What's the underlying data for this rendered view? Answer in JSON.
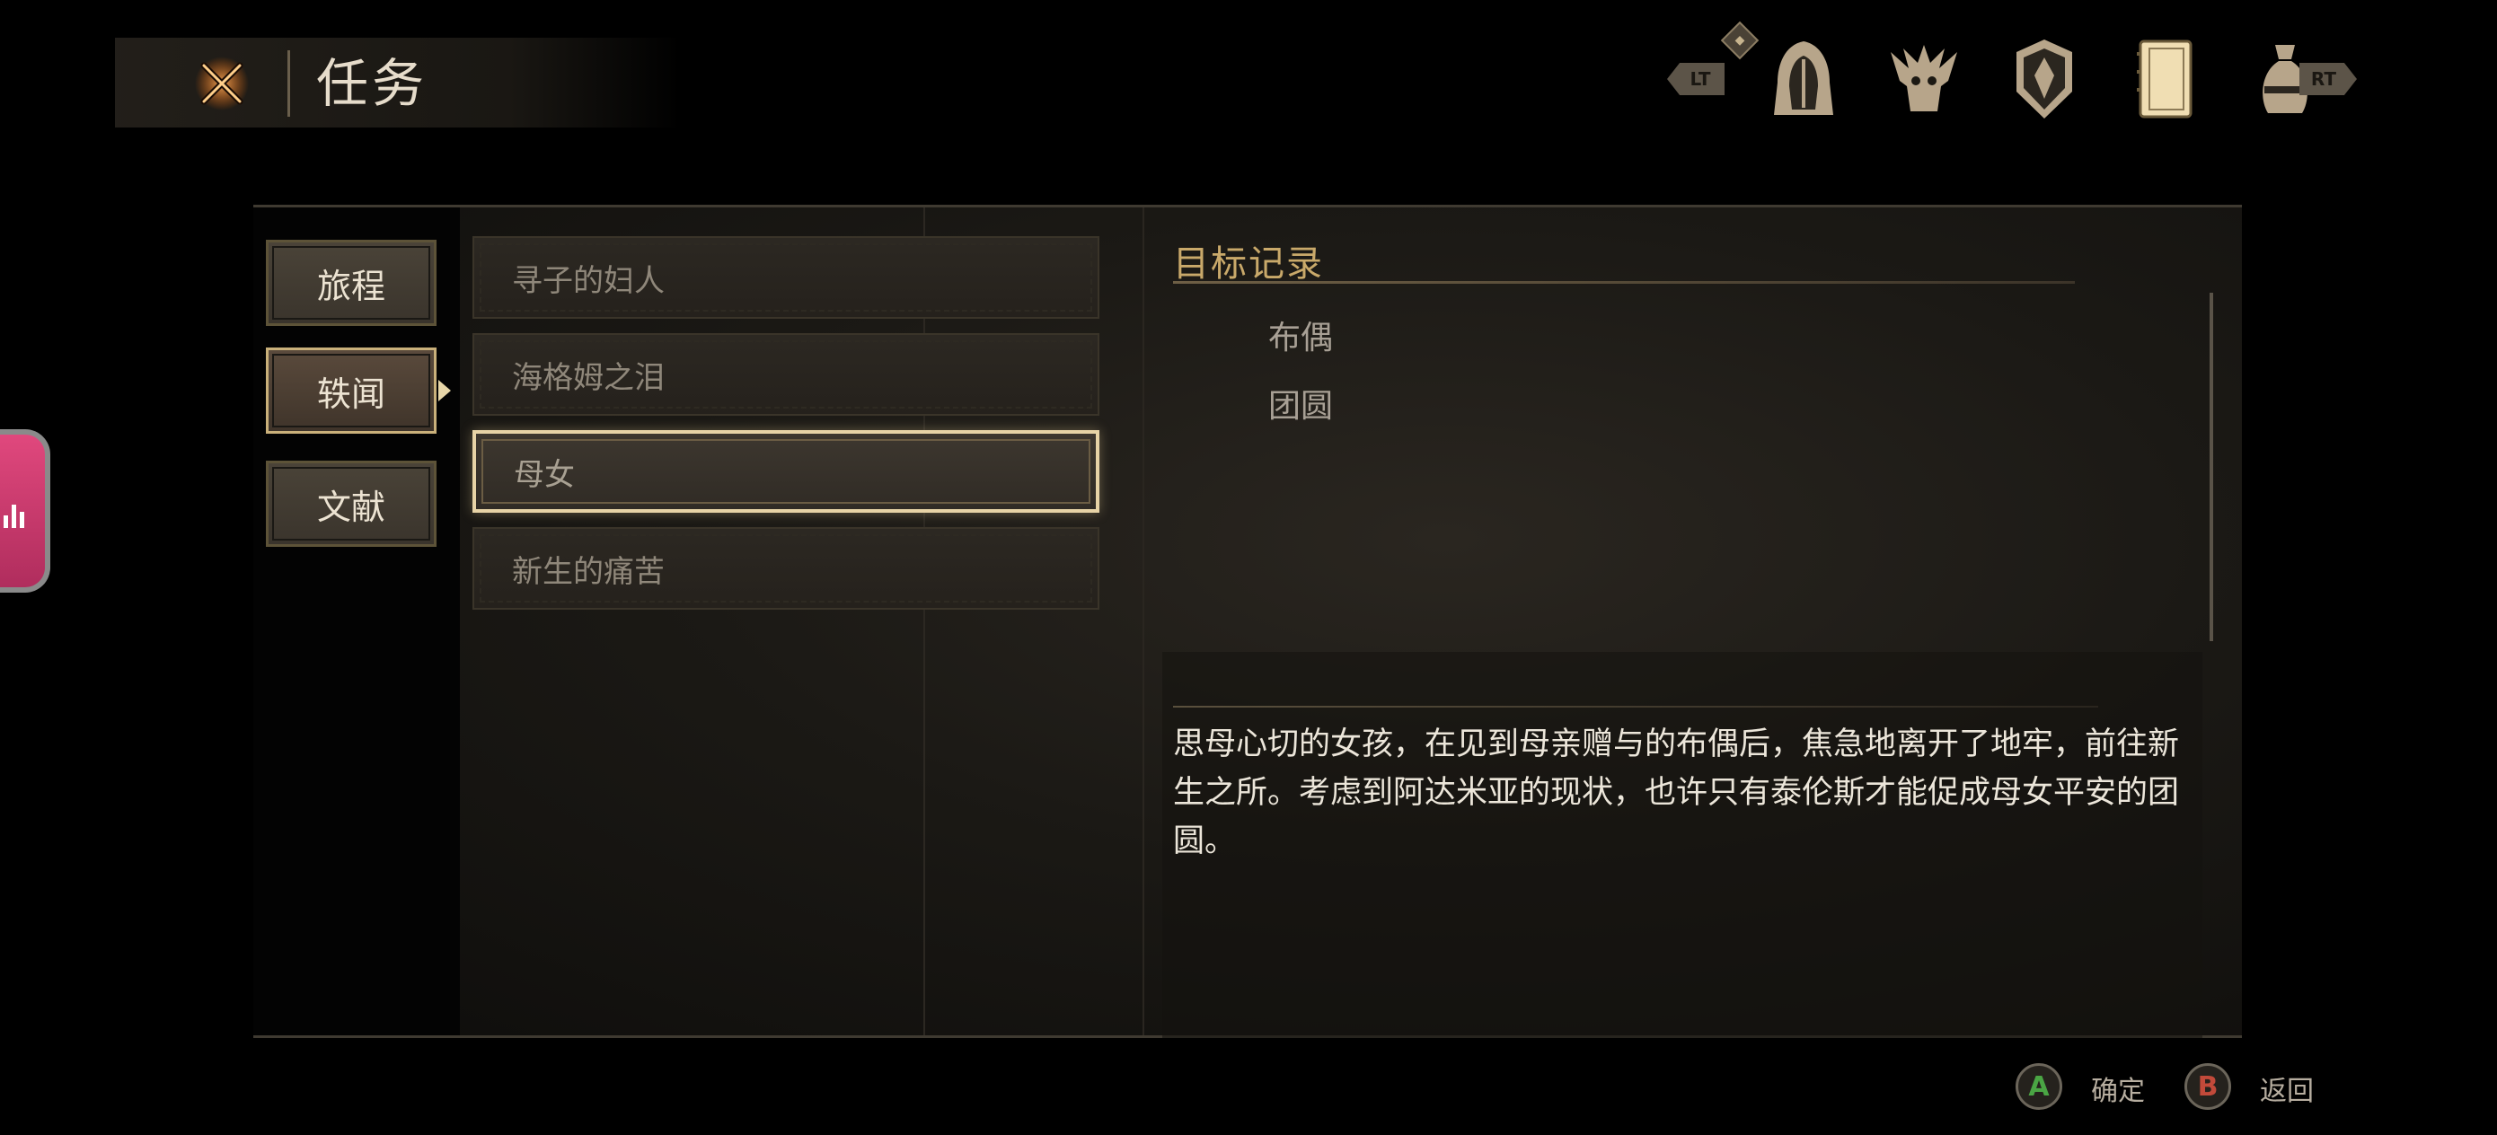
{
  "header": {
    "title": "任务",
    "close_icon": "crossed-swords-icon"
  },
  "topbar": {
    "left_bumper": "LT",
    "right_bumper": "RT",
    "tabs": [
      {
        "name": "hooded-knight-icon"
      },
      {
        "name": "demon-skull-icon"
      },
      {
        "name": "emblem-shield-icon"
      },
      {
        "name": "journal-book-icon"
      },
      {
        "name": "money-bag-icon"
      }
    ],
    "accent": "#c7b48e"
  },
  "categories": [
    {
      "label": "旅程",
      "active": false
    },
    {
      "label": "轶闻",
      "active": true
    },
    {
      "label": "文献",
      "active": false
    }
  ],
  "quests": [
    {
      "label": "寻子的妇人",
      "selected": false
    },
    {
      "label": "海格姆之泪",
      "selected": false
    },
    {
      "label": "母女",
      "selected": true
    },
    {
      "label": "新生的痛苦",
      "selected": false
    }
  ],
  "objectives": {
    "title": "目标记录",
    "items": [
      "布偶",
      "团圆"
    ]
  },
  "description": "思母心切的女孩，在见到母亲赠与的布偶后，焦急地离开了地牢，前往新生之所。考虑到阿达米亚的现状，也许只有泰伦斯才能促成母女平安的团圆。",
  "prompts": {
    "confirm_button": "A",
    "confirm_label": "确定",
    "back_button": "B",
    "back_label": "返回"
  },
  "colors": {
    "gold": "#c9a96a",
    "selected_border": "#e7d3a6",
    "a_button": "#4aa544",
    "b_button": "#c24a3a"
  }
}
